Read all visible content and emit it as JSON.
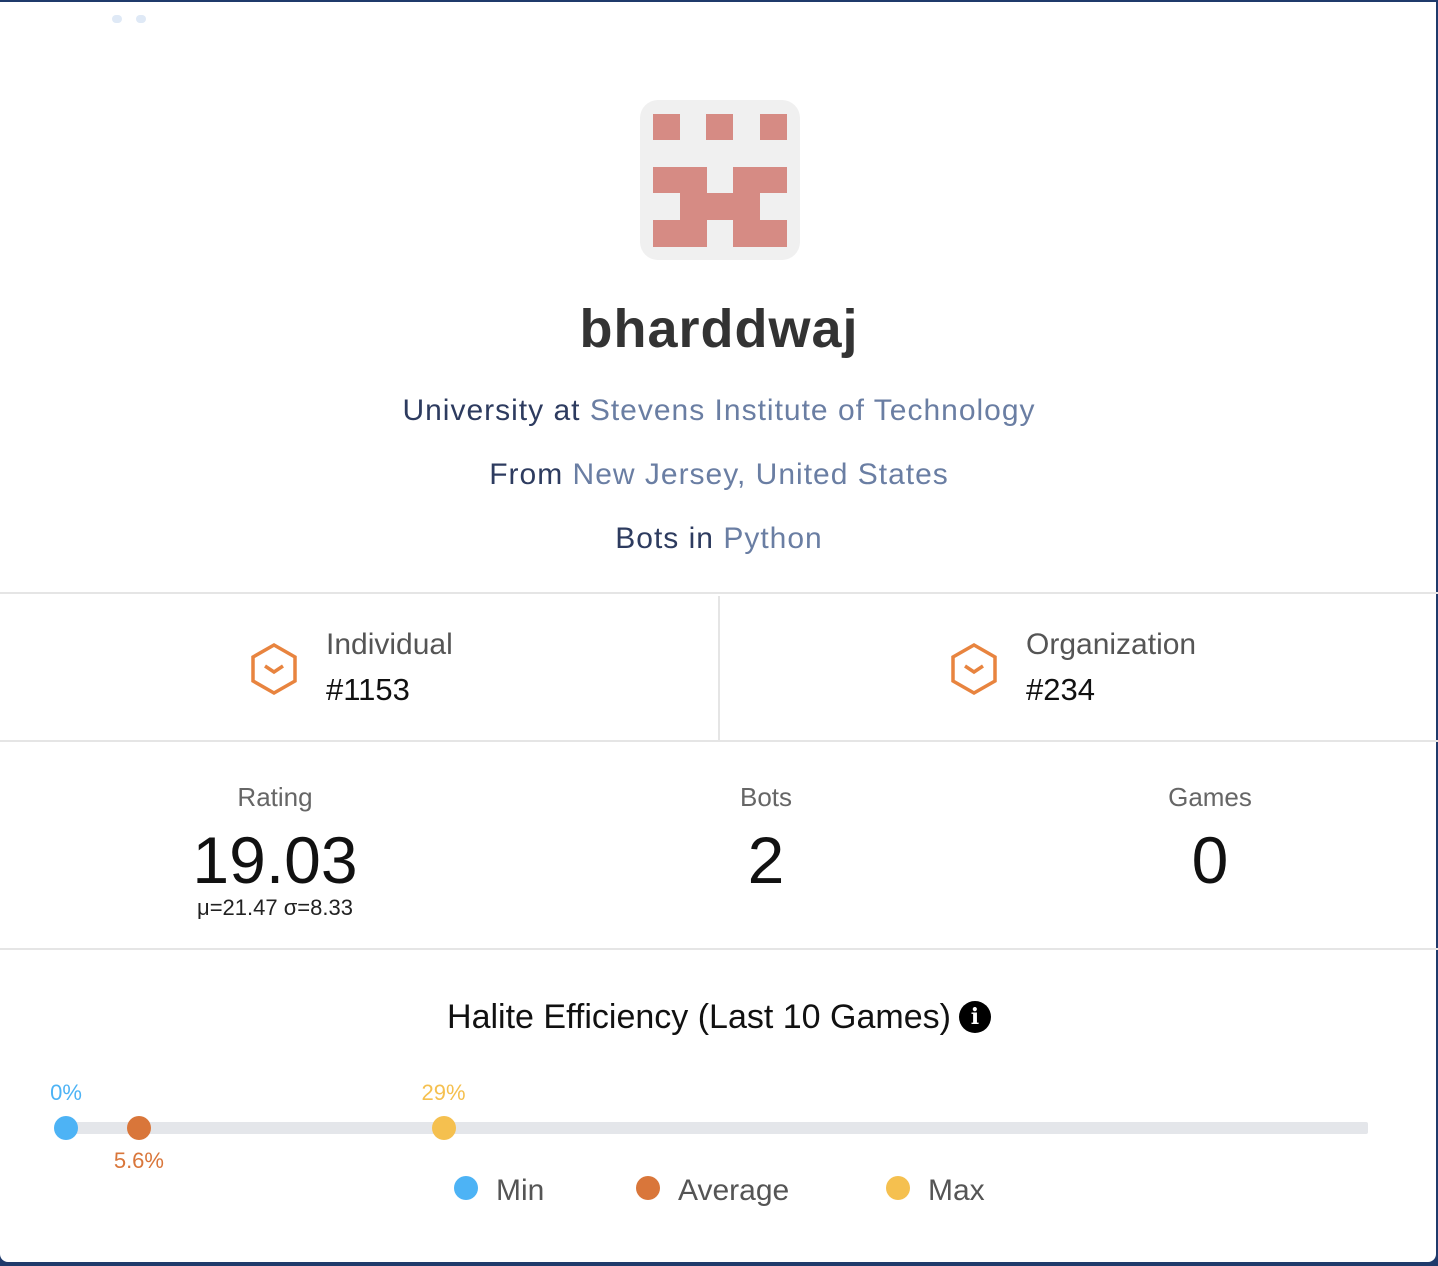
{
  "profile": {
    "username": "bharddwaj",
    "university_prefix": "University at ",
    "university": "Stevens Institute of Technology",
    "location_prefix": "From ",
    "location": "New Jersey, United States",
    "language_prefix": "Bots in ",
    "language": "Python"
  },
  "ranks": {
    "individual_label": "Individual",
    "individual_value": "#1153",
    "organization_label": "Organization",
    "organization_value": "#234",
    "icon_color": "#e8843f"
  },
  "stats": {
    "rating_label": "Rating",
    "rating_value": "19.03",
    "rating_detail": "μ=21.47 σ=8.33",
    "bots_label": "Bots",
    "bots_value": "2",
    "games_label": "Games",
    "games_value": "0"
  },
  "efficiency": {
    "title": "Halite Efficiency (Last 10 Games)",
    "info_icon": "info-icon",
    "min_label": "0%",
    "min_value": 0,
    "avg_label": "5.6%",
    "avg_value": 5.6,
    "max_label": "29%",
    "max_value": 29,
    "legend_min": "Min",
    "legend_avg": "Average",
    "legend_max": "Max",
    "colors": {
      "min": "#4db3f5",
      "avg": "#d9763a",
      "max": "#f5c04f"
    }
  }
}
